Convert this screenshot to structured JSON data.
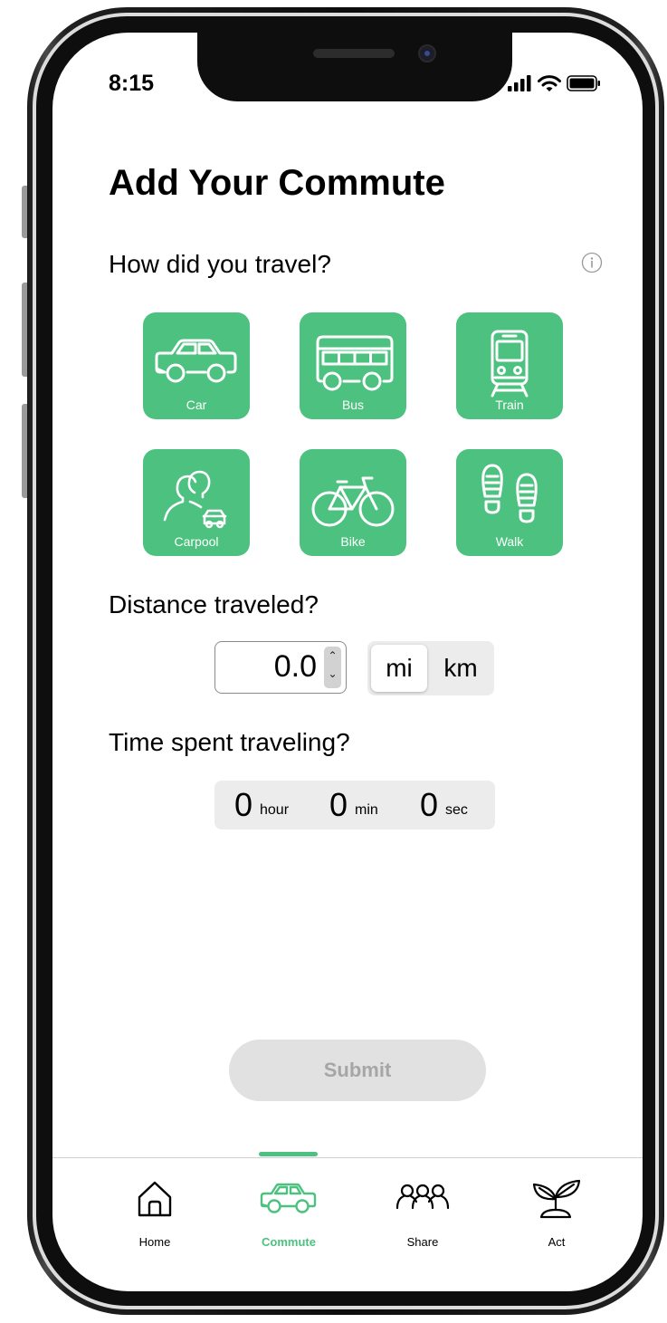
{
  "status_bar": {
    "time": "8:15"
  },
  "page": {
    "title": "Add Your Commute",
    "travel_question": "How did you travel?",
    "distance_question": "Distance traveled?",
    "time_question": "Time spent traveling?"
  },
  "modes": [
    {
      "label": "Car",
      "icon": "car-icon"
    },
    {
      "label": "Bus",
      "icon": "bus-icon"
    },
    {
      "label": "Train",
      "icon": "train-icon"
    },
    {
      "label": "Carpool",
      "icon": "carpool-icon"
    },
    {
      "label": "Bike",
      "icon": "bike-icon"
    },
    {
      "label": "Walk",
      "icon": "footprints-icon"
    }
  ],
  "distance": {
    "value": "0.0",
    "units": [
      "mi",
      "km"
    ],
    "selected_unit": "mi"
  },
  "duration": {
    "hour_value": "0",
    "hour_label": "hour",
    "min_value": "0",
    "min_label": "min",
    "sec_value": "0",
    "sec_label": "sec"
  },
  "submit_label": "Submit",
  "tabs": [
    {
      "label": "Home",
      "icon": "home-icon"
    },
    {
      "label": "Commute",
      "icon": "car-icon",
      "active": true
    },
    {
      "label": "Share",
      "icon": "people-icon"
    },
    {
      "label": "Act",
      "icon": "plant-icon"
    }
  ],
  "colors": {
    "accent": "#4dc17f",
    "disabled_button": "#e1e1e1",
    "disabled_text": "#a6a6a6",
    "segment_bg": "#ececec"
  }
}
